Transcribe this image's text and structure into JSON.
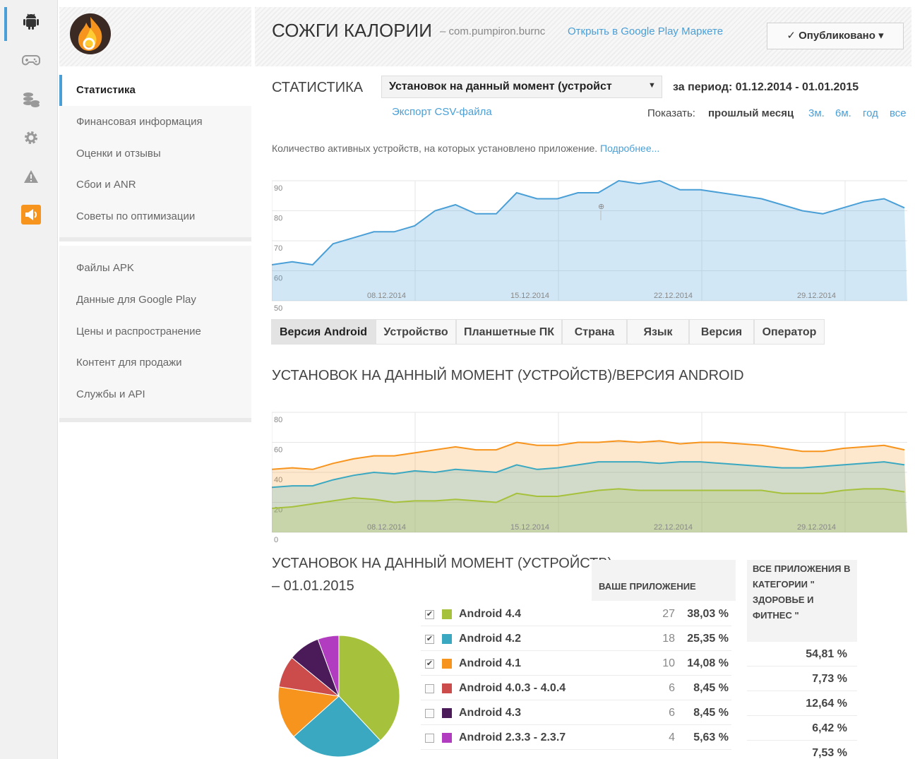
{
  "rail": {
    "icons": [
      "android-icon",
      "gamepad-icon",
      "coins-icon",
      "gear-icon",
      "warning-icon",
      "megaphone-icon"
    ],
    "accent": "#4a9fd6",
    "promo_color": "#f7941d"
  },
  "nav": {
    "group1": [
      "Статистика",
      "Финансовая информация",
      "Оценки и отзывы",
      "Сбои и ANR",
      "Советы по оптимизации"
    ],
    "group2": [
      "Файлы APK",
      "Данные для Google Play",
      "Цены и распространение",
      "Контент для продажи",
      "Службы и API"
    ]
  },
  "header": {
    "title": "СОЖГИ КАЛОРИИ",
    "package": "– com.pumpiron.burnc",
    "play_link": "Открыть в Google Play Маркете",
    "publish_label": "✓ Опубликовано ▾"
  },
  "stats": {
    "title": "СТАТИСТИКА",
    "metric": "Установок на данный момент (устройст",
    "period": "за период: 01.12.2014 - 01.01.2015",
    "export": "Экспорт CSV-файла",
    "show_label": "Показать:",
    "range_current": "прошлый месяц",
    "range_links": [
      "3м.",
      "6м.",
      "год",
      "все"
    ],
    "description": "Количество активных устройств, на которых установлено приложение.",
    "more_link": "Подробнее..."
  },
  "tabs": [
    "Версия Android",
    "Устройство",
    "Планшетные ПК",
    "Страна",
    "Язык",
    "Версия",
    "Оператор"
  ],
  "section2_title": "УСТАНОВОК НА ДАННЫЙ МОМЕНТ (УСТРОЙСТВ)/ВЕРСИЯ ANDROID",
  "section3": {
    "title": "УСТАНОВОК НА ДАННЫЙ МОМЕНТ (УСТРОЙСТВ)",
    "date": "– 01.01.2015",
    "col_app": "ВАШЕ ПРИЛОЖЕНИЕ",
    "col_category": "ВСЕ ПРИЛОЖЕНИЯ В КАТЕГОРИИ \" ЗДОРОВЬЕ И ФИТНЕС \"",
    "rows": [
      {
        "name": "Android 4.4",
        "count": "27",
        "pct": "38,03 %",
        "cat": "54,81 %",
        "checked": true,
        "color": "#a6c13c"
      },
      {
        "name": "Android 4.2",
        "count": "18",
        "pct": "25,35 %",
        "cat": "7,73 %",
        "checked": true,
        "color": "#3aa8c1"
      },
      {
        "name": "Android 4.1",
        "count": "10",
        "pct": "14,08 %",
        "cat": "12,64 %",
        "checked": true,
        "color": "#f7941d"
      },
      {
        "name": "Android 4.0.3 - 4.0.4",
        "count": "6",
        "pct": "8,45 %",
        "cat": "6,42 %",
        "checked": false,
        "color": "#cc4b4b"
      },
      {
        "name": "Android 4.3",
        "count": "6",
        "pct": "8,45 %",
        "cat": "7,53 %",
        "checked": false,
        "color": "#4b1a59"
      },
      {
        "name": "Android 2.3.3 - 2.3.7",
        "count": "4",
        "pct": "5,63 %",
        "cat": "",
        "checked": false,
        "color": "#b23cbf"
      }
    ]
  },
  "chart_data": [
    {
      "type": "area",
      "x_ticks": [
        "08.12.2014",
        "15.12.2014",
        "22.12.2014",
        "29.12.2014"
      ],
      "ylim": [
        50,
        90
      ],
      "y_ticks": [
        90,
        80,
        70,
        60,
        50
      ],
      "series": [
        {
          "values": [
            62,
            63,
            62,
            69,
            71,
            73,
            73,
            75,
            80,
            82,
            79,
            79,
            86,
            84,
            84,
            86,
            86,
            90,
            89,
            90,
            87,
            87,
            86,
            85,
            84,
            82,
            80,
            79,
            81,
            83,
            84,
            81
          ],
          "color": "#4a9fd6"
        }
      ],
      "marker_annotation": "⊕"
    },
    {
      "type": "area",
      "x_ticks": [
        "08.12.2014",
        "15.12.2014",
        "22.12.2014",
        "29.12.2014"
      ],
      "ylim": [
        0,
        80
      ],
      "y_ticks": [
        80,
        60,
        40,
        20,
        0
      ],
      "series": [
        {
          "values": [
            42,
            43,
            42,
            46,
            49,
            51,
            51,
            53,
            55,
            57,
            55,
            55,
            60,
            58,
            58,
            60,
            60,
            61,
            60,
            61,
            59,
            60,
            60,
            59,
            58,
            56,
            54,
            54,
            56,
            57,
            58,
            55
          ],
          "color": "#f7941d"
        },
        {
          "values": [
            30,
            31,
            31,
            35,
            38,
            40,
            39,
            41,
            40,
            42,
            41,
            40,
            45,
            42,
            43,
            45,
            47,
            47,
            47,
            46,
            47,
            47,
            46,
            45,
            44,
            43,
            43,
            44,
            45,
            46,
            47,
            45
          ],
          "color": "#3aa8c1"
        },
        {
          "values": [
            16,
            17,
            19,
            21,
            23,
            22,
            20,
            21,
            21,
            22,
            21,
            20,
            26,
            24,
            24,
            26,
            28,
            29,
            28,
            28,
            28,
            28,
            28,
            28,
            28,
            26,
            26,
            26,
            28,
            29,
            29,
            27
          ],
          "color": "#a6c13c"
        }
      ]
    },
    {
      "type": "pie",
      "labels": [
        "Android 4.4",
        "Android 4.2",
        "Android 4.1",
        "Android 4.0.3 - 4.0.4",
        "Android 4.3",
        "Android 2.3.3 - 2.3.7"
      ],
      "values": [
        38.03,
        25.35,
        14.08,
        8.45,
        8.45,
        5.63
      ],
      "colors": [
        "#a6c13c",
        "#3aa8c1",
        "#f7941d",
        "#cc4b4b",
        "#4b1a59",
        "#b23cbf"
      ]
    }
  ]
}
